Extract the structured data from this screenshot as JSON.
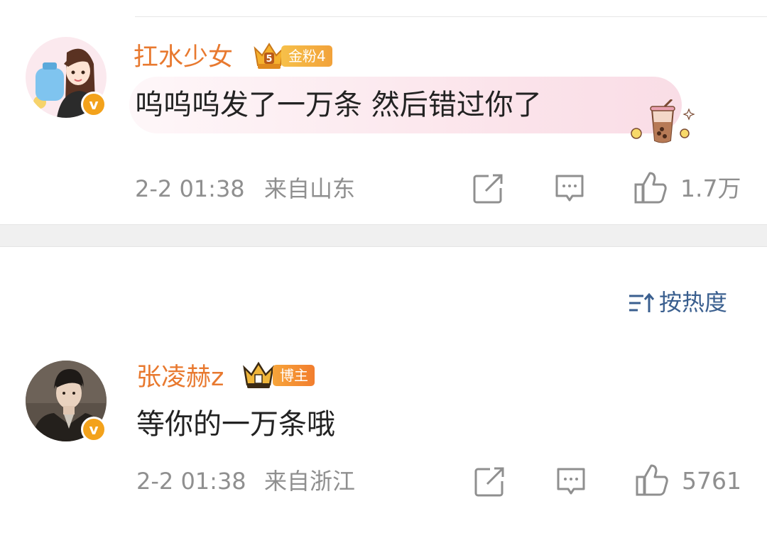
{
  "comments": [
    {
      "username": "扛水少女",
      "rank_badge": "金粉4",
      "badge_level": "5",
      "content": "呜呜呜发了一万条 然后错过你了",
      "time": "2-2 01:38",
      "location": "来自山东",
      "likes": "1.7万"
    },
    {
      "username": "张凌赫z",
      "rank_badge": "博主",
      "content": "等你的一万条哦",
      "time": "2-2 01:38",
      "location": "来自浙江",
      "likes": "5761"
    }
  ],
  "sort": {
    "label": "按热度",
    "icon": "sort-icon"
  },
  "colors": {
    "username": "#e8792f",
    "badge_gold": "#f3a21b",
    "link_blue": "#3a5f8f",
    "meta_gray": "#8f8f8f"
  }
}
